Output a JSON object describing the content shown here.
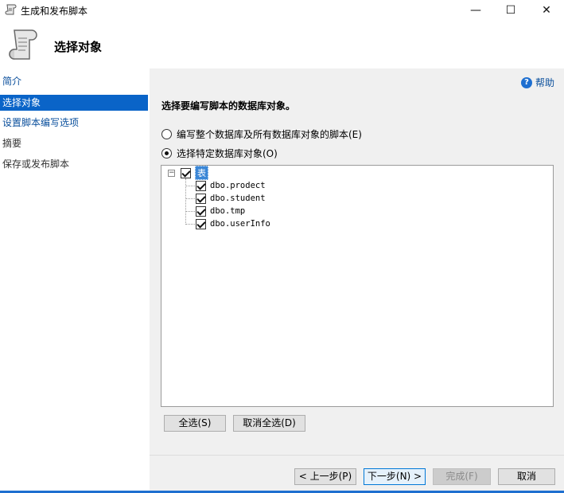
{
  "window": {
    "title": "生成和发布脚本",
    "controls": {
      "minimize": "—",
      "maximize": "☐",
      "close": "✕"
    }
  },
  "header": {
    "title": "选择对象"
  },
  "nav": {
    "items": [
      {
        "label": "简介"
      },
      {
        "label": "选择对象"
      },
      {
        "label": "设置脚本编写选项"
      },
      {
        "label": "摘要"
      },
      {
        "label": "保存或发布脚本"
      }
    ]
  },
  "main": {
    "help_label": "帮助",
    "section_title": "选择要编写脚本的数据库对象。",
    "radio_all": "编写整个数据库及所有数据库对象的脚本(E)",
    "radio_specific": "选择特定数据库对象(O)",
    "tree": {
      "root_label": "表",
      "children": [
        {
          "label": "dbo.prodect"
        },
        {
          "label": "dbo.student"
        },
        {
          "label": "dbo.tmp"
        },
        {
          "label": "dbo.userInfo"
        }
      ]
    },
    "select_all": "全选(S)",
    "deselect_all": "取消全选(D)"
  },
  "footer": {
    "prev": "< 上一步(P)",
    "next": "下一步(N) >",
    "finish": "完成(F)",
    "cancel": "取消"
  },
  "colors": {
    "accent": "#0a64c8",
    "link": "#0a4f9c",
    "panel_bg": "#f0f0f0"
  }
}
